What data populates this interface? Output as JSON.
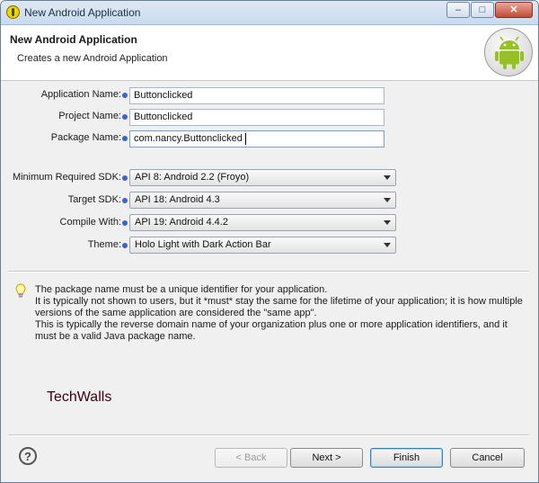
{
  "window": {
    "title": "New Android Application",
    "controls": {
      "minimize": "–",
      "maximize": "□",
      "close": "✕"
    }
  },
  "banner": {
    "title": "New Android Application",
    "subtitle": "Creates a new Android Application",
    "logo_icon": "android-robot-icon"
  },
  "form": {
    "application_name": {
      "label": "Application Name:",
      "value": "Buttonclicked"
    },
    "project_name": {
      "label": "Project Name:",
      "value": "Buttonclicked"
    },
    "package_name": {
      "label": "Package Name:",
      "value": "com.nancy.Buttonclicked"
    },
    "min_sdk": {
      "label": "Minimum Required SDK:",
      "value": "API 8: Android 2.2 (Froyo)"
    },
    "target_sdk": {
      "label": "Target SDK:",
      "value": "API 18: Android 4.3"
    },
    "compile_with": {
      "label": "Compile With:",
      "value": "API 19: Android 4.4.2"
    },
    "theme": {
      "label": "Theme:",
      "value": "Holo Light with Dark Action Bar"
    }
  },
  "info": {
    "icon": "lightbulb-icon",
    "lines": [
      "The package name must be a unique identifier for your application.",
      "It is typically not shown to users, but it *must* stay the same for the lifetime of your application; it is how multiple",
      "versions of the same application are considered the \"same app\".",
      "This is typically the reverse domain name of your organization plus one or more application identifiers, and it",
      "must be a valid Java package name."
    ]
  },
  "watermark": "TechWalls",
  "footer": {
    "help": "?",
    "back": "< Back",
    "next": "Next >",
    "finish": "Finish",
    "cancel": "Cancel"
  },
  "colors": {
    "info_dot": "#3b64c7",
    "android_green": "#97c024",
    "watermark": "#3d0010"
  }
}
